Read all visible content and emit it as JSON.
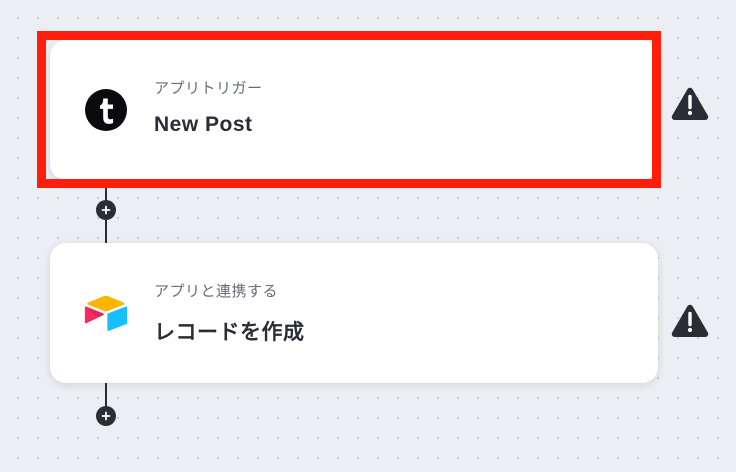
{
  "flow": {
    "steps": [
      {
        "type_label": "アプリトリガー",
        "title": "New Post",
        "app": "tumblr",
        "app_icon": "tumblr-icon",
        "selected": true,
        "status": "warning",
        "status_icon": "warning-icon"
      },
      {
        "type_label": "アプリと連携する",
        "title": "レコードを作成",
        "app": "airtable",
        "app_icon": "airtable-icon",
        "selected": false,
        "status": "warning",
        "status_icon": "warning-icon"
      }
    ],
    "add_step_icon": "plus-icon"
  },
  "colors": {
    "canvas_background": "#eceef3",
    "card_background": "#ffffff",
    "connector": "#2b2d36",
    "selection_highlight": "#ff1e0b",
    "warning": "#2b2d36",
    "airtable_yellow": "#fcb400",
    "airtable_blue": "#18bfff",
    "airtable_red": "#f82b60"
  }
}
